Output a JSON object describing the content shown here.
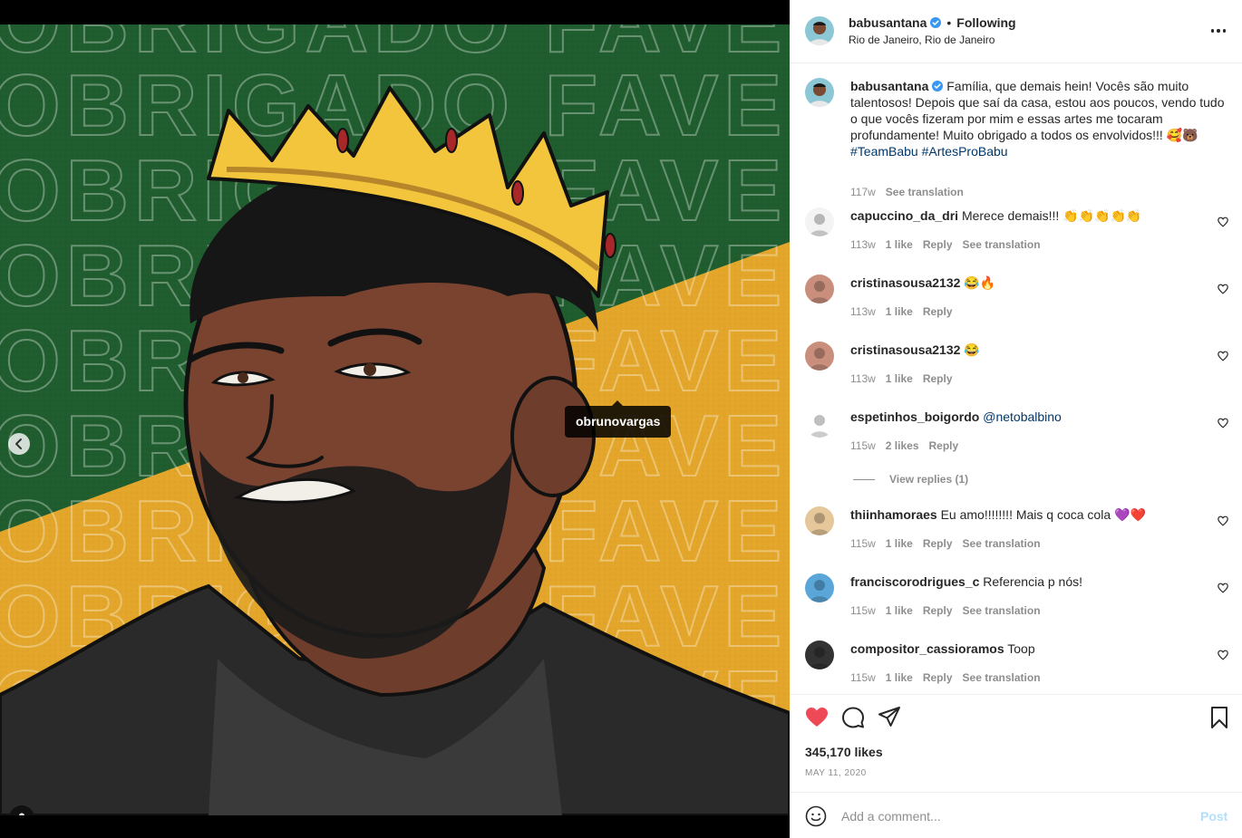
{
  "post": {
    "image": {
      "poster_text_row": "OBRIGADO FAVELA",
      "tag_label": "obrunovargas",
      "carousel_dots": 10,
      "active_dot": 9,
      "colors": {
        "green": "#1f5c2e",
        "yellow": "#e3a62a"
      }
    },
    "header": {
      "username": "babusantana",
      "separator": "•",
      "follow_status": "Following",
      "location": "Rio de Janeiro, Rio de Janeiro",
      "more_icon": "more-horizontal-icon"
    },
    "caption": {
      "username": "babusantana",
      "text": "Família, que demais hein! Vocês são muito talentosos! Depois que saí da casa, estou aos poucos, vendo tudo o que vocês fizeram por mim e essas artes me tocaram profundamente! Muito obrigado a todos os envolvidos!!! 🥰🐻",
      "hashtags": [
        "#TeamBabu",
        "#ArtesProBabu"
      ],
      "age": "117w",
      "translate": "See translation"
    },
    "comments": [
      {
        "username": "capuccino_da_dri",
        "text": "Merece demais!!! 👏👏👏👏👏",
        "age": "113w",
        "likes": "1 like",
        "reply": "Reply",
        "translate": "See translation"
      },
      {
        "username": "cristinasousa2132",
        "text": "😂🔥",
        "age": "113w",
        "likes": "1 like",
        "reply": "Reply",
        "translate": ""
      },
      {
        "username": "cristinasousa2132",
        "text": "😂",
        "age": "113w",
        "likes": "1 like",
        "reply": "Reply",
        "translate": ""
      },
      {
        "username": "espetinhos_boigordo",
        "text": "@netobalbino",
        "age": "115w",
        "likes": "2 likes",
        "reply": "Reply",
        "translate": "",
        "view_replies": "View replies (1)"
      },
      {
        "username": "thiinhamoraes",
        "text": "Eu amo!!!!!!!! Mais q coca cola 💜❤️",
        "age": "115w",
        "likes": "1 like",
        "reply": "Reply",
        "translate": "See translation"
      },
      {
        "username": "franciscorodrigues_c",
        "text": "Referencia p nós!",
        "age": "115w",
        "likes": "1 like",
        "reply": "Reply",
        "translate": "See translation"
      },
      {
        "username": "compositor_cassioramos",
        "text": "Toop",
        "age": "115w",
        "likes": "1 like",
        "reply": "Reply",
        "translate": "See translation"
      }
    ],
    "actions": {
      "like_color": "#ed4956",
      "likes": "345,170 likes",
      "date": "MAY 11, 2020"
    },
    "add_comment": {
      "placeholder": "Add a comment...",
      "post_label": "Post"
    }
  }
}
